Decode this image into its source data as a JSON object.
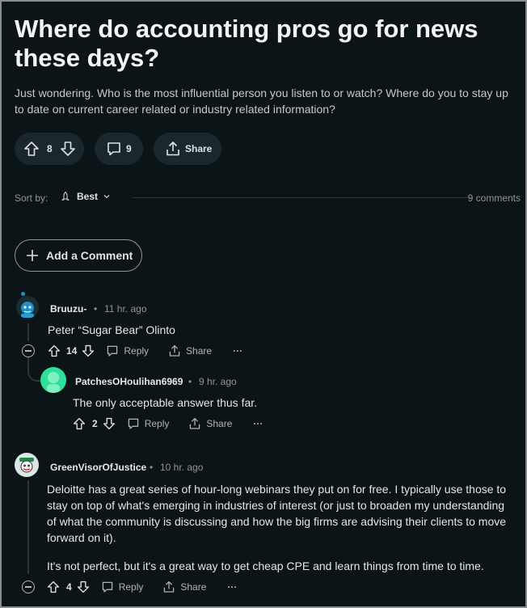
{
  "post": {
    "title": "Where do accounting pros go for news these days?",
    "body": "Just wondering. Who is the most influential person you listen to or watch? Where do you to stay up to date on current career related or industry related information?",
    "vote_count": "8",
    "comment_count": "9",
    "share_label": "Share"
  },
  "sort": {
    "label": "Sort by:",
    "value": "Best",
    "comments_total": "9 comments"
  },
  "add_comment_label": "Add a Comment",
  "comments": [
    {
      "user": "Bruuzu-",
      "time": "11 hr. ago",
      "text": "Peter “Sugar Bear” Olinto",
      "votes": "14",
      "reply_label": "Reply",
      "share_label": "Share",
      "more_label": "···"
    },
    {
      "user": "PatchesOHoulihan6969",
      "time": "9 hr. ago",
      "text": "The only acceptable answer thus far.",
      "votes": "2",
      "reply_label": "Reply",
      "share_label": "Share",
      "more_label": "···"
    },
    {
      "user": "GreenVisorOfJustice",
      "time": "10 hr. ago",
      "text_p1": "Deloitte has a great series of hour-long webinars they put on for free. I typically use those to stay on top of what's emerging in industries of interest (or just to broaden my understanding of what the community is discussing and how the big firms are advising their clients to move forward on it).",
      "text_p2": "It's not perfect, but it's a great way to get cheap CPE and learn things from time to time.",
      "votes": "4",
      "reply_label": "Reply",
      "share_label": "Share",
      "more_label": "···"
    }
  ],
  "colors": {
    "background": "#0b1416",
    "pill": "#1a282d",
    "muted_text": "#8c979b"
  }
}
